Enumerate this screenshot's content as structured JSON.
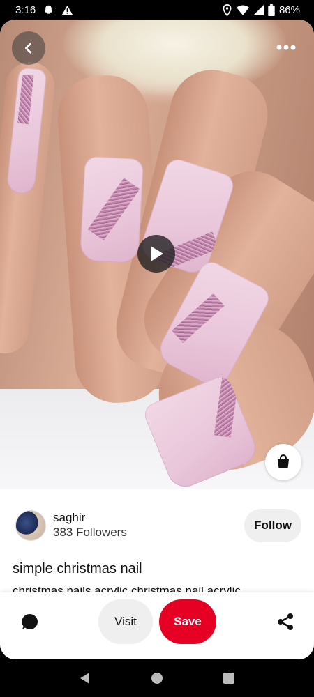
{
  "status_bar": {
    "time": "3:16",
    "battery": "86%",
    "icons": [
      "snapchat-icon",
      "warning-icon",
      "location-icon",
      "wifi-icon",
      "signal-icon",
      "battery-icon"
    ]
  },
  "pin": {
    "media_type": "video",
    "buttons": [
      "back-icon",
      "more-icon",
      "play-icon",
      "shopping-bag-icon"
    ]
  },
  "creator": {
    "name": "saghir",
    "followers": "383 Followers",
    "follow_label": "Follow"
  },
  "pin_info": {
    "title": "simple christmas nail",
    "description": "christmas nails acrylic christmas nail acrylic"
  },
  "actions": {
    "visit_label": "Visit",
    "save_label": "Save",
    "icons": [
      "comment-icon",
      "share-icon"
    ],
    "save_color": "#e60023"
  },
  "nav_bar": {
    "icons": [
      "nav-back-icon",
      "nav-home-icon",
      "nav-recents-icon"
    ]
  }
}
